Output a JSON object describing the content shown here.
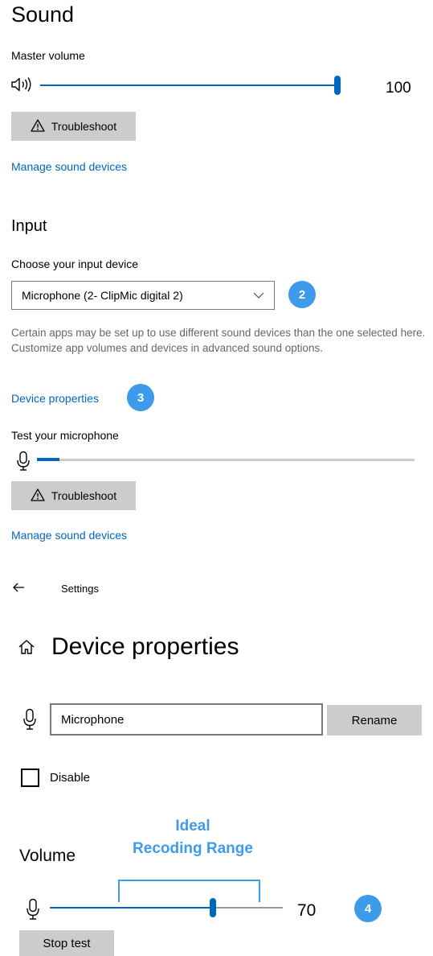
{
  "sound": {
    "title": "Sound",
    "master_volume_label": "Master volume",
    "master_volume_value": "100",
    "master_volume_level": 1.0,
    "troubleshoot_label": "Troubleshoot",
    "manage_devices_link": "Manage sound devices"
  },
  "input": {
    "title": "Input",
    "choose_device_label": "Choose your input device",
    "selected_device": "Microphone (2- ClipMic digital 2)",
    "note": "Certain apps may be set up to use different sound devices than the one selected here. Customize app volumes and devices in advanced sound options.",
    "device_properties_link": "Device properties",
    "test_mic_label": "Test your microphone",
    "mic_level": 0.06,
    "troubleshoot_label": "Troubleshoot",
    "manage_devices_link": "Manage sound devices"
  },
  "badges": {
    "b2": "2",
    "b3": "3",
    "b4": "4"
  },
  "settings_nav": {
    "back_label": "Settings"
  },
  "device_properties": {
    "title": "Device properties",
    "name_value": "Microphone",
    "rename_label": "Rename",
    "disable_label": "Disable",
    "volume_label": "Volume",
    "volume_value": "70",
    "volume_level": 0.7,
    "stop_test_label": "Stop test"
  },
  "annotation": {
    "line1": "Ideal",
    "line2": "Recoding Range"
  },
  "colors": {
    "accent": "#0067c0",
    "badge": "#3d9be9",
    "button_gray": "#cccccc"
  }
}
